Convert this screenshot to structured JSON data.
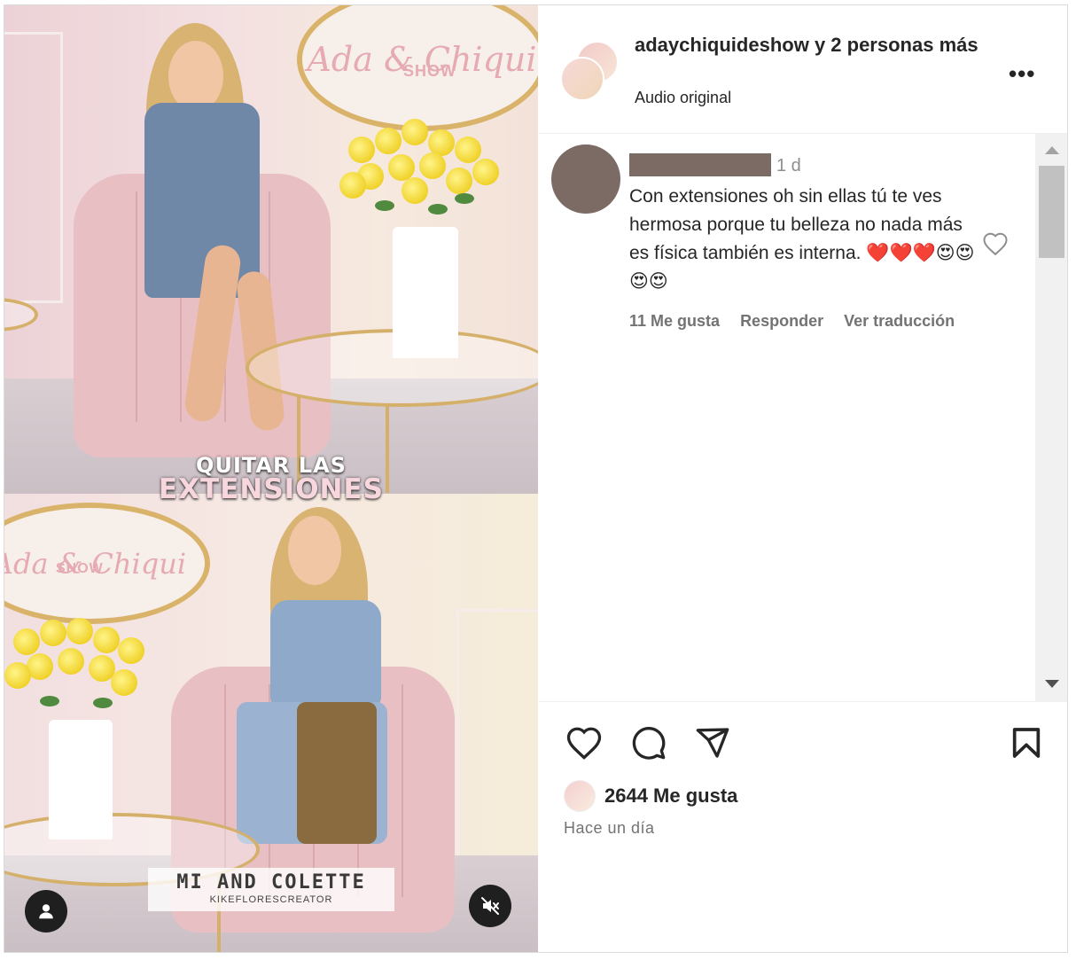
{
  "video": {
    "caption_line1": "QUITAR LAS",
    "caption_line2": "EXTENSIONES",
    "credit_name": "MI AND COLETTE",
    "credit_sub": "KIKEFLORESCREATOR",
    "logo_text": "Ada & Chiqui",
    "logo_sub": "SHOW",
    "logo_text_2": "Ada & Chiqui",
    "logo_sub_2": "SHOW",
    "user_button_icon": "user-icon",
    "mute_button_icon": "muted-speaker-icon"
  },
  "header": {
    "author": "adaychiquideshow",
    "collab": " y 2 personas más",
    "audio": "Audio original",
    "more_icon": "•••"
  },
  "comment": {
    "time": "1 d",
    "text": "Con extensiones oh sin ellas tú te ves hermosa porque tu belleza no nada más es física también es interna. ❤️❤️❤️😍😍😍😍",
    "likes": "11 Me gusta",
    "reply": "Responder",
    "translate": "Ver traducción"
  },
  "post": {
    "likes": "2644 Me gusta",
    "time_ago": "Hace un día"
  },
  "colors": {
    "text": "#262626",
    "muted": "#737373",
    "redaction": "#7c6a64",
    "accent_gold": "#d4b06a"
  }
}
